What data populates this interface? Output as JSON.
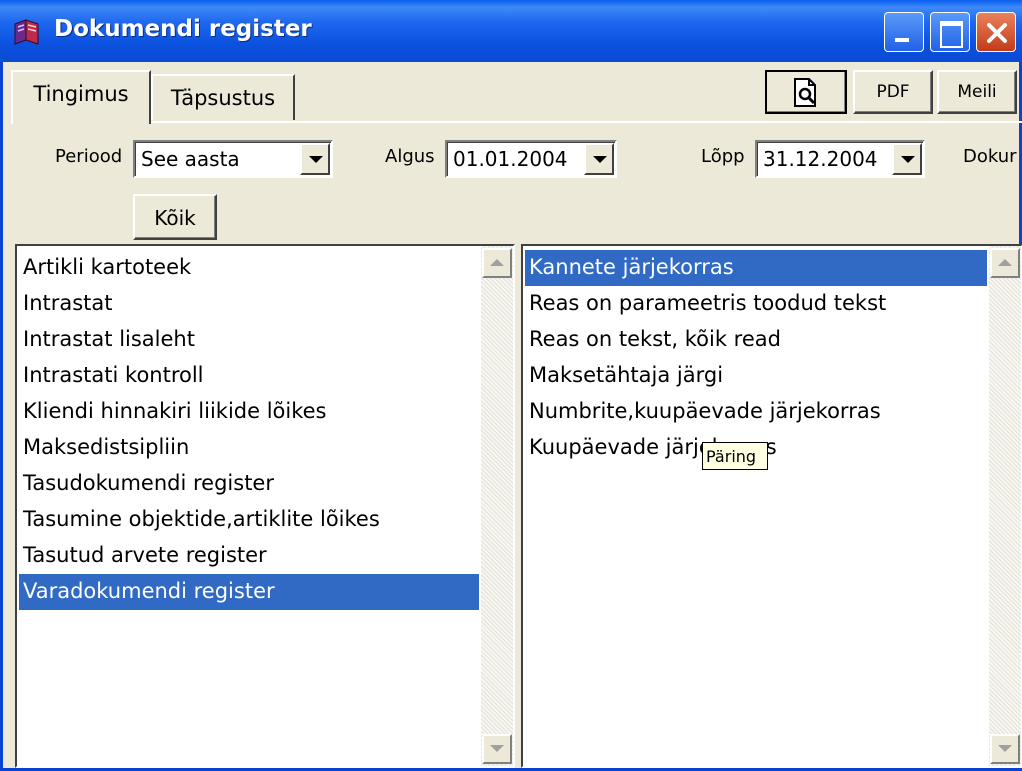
{
  "window": {
    "title": "Dokumendi register",
    "app_icon": "books-icon",
    "controls": [
      "minimize-icon",
      "maximize-icon",
      "close-icon"
    ]
  },
  "tabs": [
    {
      "label": "Tingimus",
      "active": true
    },
    {
      "label": "Täpsustus",
      "active": false
    }
  ],
  "toolbar": {
    "preview_icon": "print-preview-icon",
    "pdf_label": "PDF",
    "mail_label": "Meili"
  },
  "filters": {
    "period_label": "Periood",
    "period_value": "See aasta",
    "start_label": "Algus",
    "start_value": "01.01.2004",
    "end_label": "Lõpp",
    "end_value": "31.12.2004",
    "doc_label": "Dokur",
    "all_button": "Kõik"
  },
  "left_list": {
    "items": [
      "Artikli kartoteek",
      "Intrastat",
      "Intrastat lisaleht",
      "Intrastati kontroll",
      "Kliendi hinnakiri liikide lõikes",
      "Maksedistsipliin",
      "Tasudokumendi register",
      "Tasumine objektide,artiklite lõikes",
      "Tasutud arvete register",
      "Varadokumendi register"
    ],
    "selected_index": 9
  },
  "right_list": {
    "items": [
      "Kannete järjekorras",
      "Reas on parameetris toodud tekst",
      "Reas on tekst, kõik read",
      "Maksetähtaja järgi",
      "Numbrite,kuupäevade järjekorras",
      "Kuupäevade järjekorras"
    ],
    "selected_index": 0
  },
  "tooltip": {
    "text": "Päring"
  },
  "colors": {
    "titlebar": "#0a52df",
    "selection": "#316ac5",
    "face": "#ece9d8",
    "tooltip_bg": "#ffffe1"
  }
}
